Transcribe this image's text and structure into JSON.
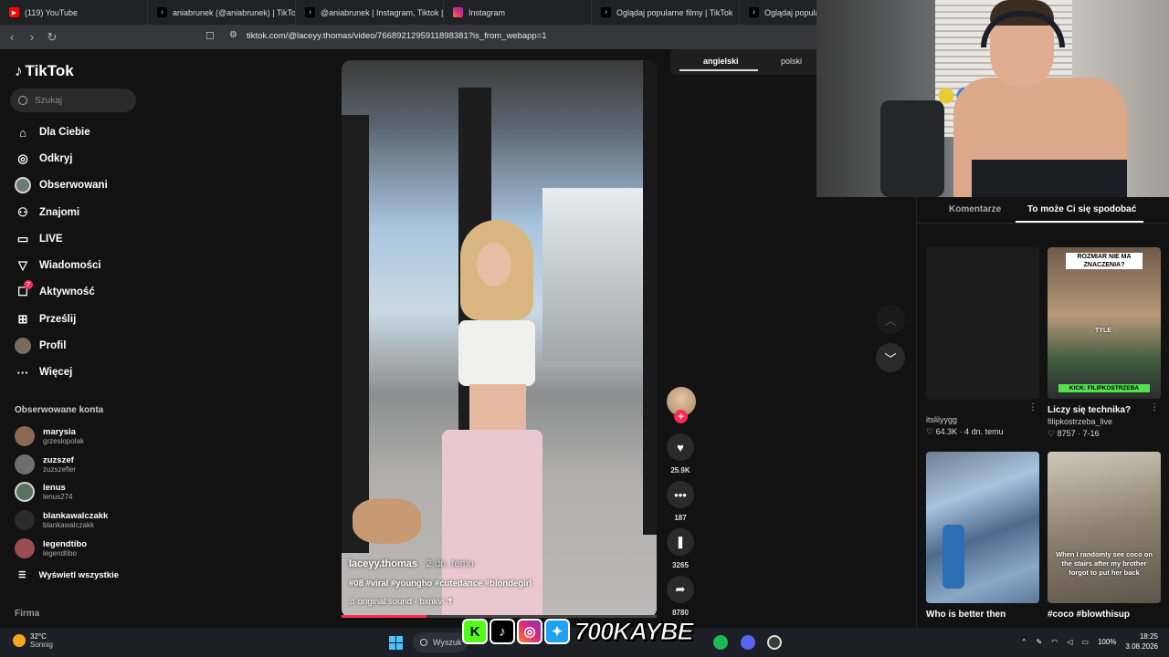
{
  "browser": {
    "tabs": [
      {
        "label": "(119) YouTube",
        "icon": "youtube-icon"
      },
      {
        "label": "aniabrunek (@aniabrunek) | TikTok",
        "icon": "tiktok-icon"
      },
      {
        "label": "@aniabrunek | Instagram, Tiktok | Li",
        "icon": "tiktok-icon"
      },
      {
        "label": "Instagram",
        "icon": "instagram-icon"
      },
      {
        "label": "Oglądaj popularne filmy | TikTok",
        "icon": "tiktok-icon"
      },
      {
        "label": "Oglądaj popularne fi",
        "icon": "tiktok-icon"
      }
    ],
    "url": "tiktok.com/@laceyy.thomas/video/7668921295911898381?is_from_webapp=1"
  },
  "sidebar": {
    "logo": "TikTok",
    "search_placeholder": "Szukaj",
    "nav": [
      {
        "label": "Dla Ciebie",
        "icon": "home-icon"
      },
      {
        "label": "Odkryj",
        "icon": "compass-icon"
      },
      {
        "label": "Obserwowani",
        "icon": "avatar-icon"
      },
      {
        "label": "Znajomi",
        "icon": "friends-icon"
      },
      {
        "label": "LIVE",
        "icon": "live-icon"
      },
      {
        "label": "Wiadomości",
        "icon": "messages-icon"
      },
      {
        "label": "Aktywność",
        "icon": "activity-icon",
        "badge": "7"
      },
      {
        "label": "Prześlij",
        "icon": "upload-icon"
      },
      {
        "label": "Profil",
        "icon": "profile-icon"
      },
      {
        "label": "Więcej",
        "icon": "more-icon"
      }
    ],
    "followed_title": "Obserwowane konta",
    "followed": [
      {
        "name": "marysia",
        "handle": "grzeslopolak",
        "color": "#8a6a55"
      },
      {
        "name": "zuzszef",
        "handle": "zuzszefler",
        "color": "#6e6e6e"
      },
      {
        "name": "lenus",
        "handle": "lenus274",
        "color": "#5a7060"
      },
      {
        "name": "blankawalczakk",
        "handle": "blankawalczakk",
        "color": "#2b2b2b"
      },
      {
        "name": "legendtibo",
        "handle": "legendtibo",
        "color": "#9a4f4f"
      }
    ],
    "show_all": "Wyświetl wszystkie",
    "footer": "Firma"
  },
  "video": {
    "username": "laceyy.thomas",
    "time": " · 2 dn. temu",
    "tags": "#08 #viral #youngho #cutedance #blondegirl",
    "sound": "original sound - bxnkvi ✝",
    "progress": 0.27
  },
  "actions": {
    "likes": "25.9K",
    "comments": "187",
    "saves": "3265",
    "shares": "8780"
  },
  "language": {
    "active": "angielski",
    "other": "polski"
  },
  "rpanel": {
    "tab_comments": "Komentarze",
    "tab_suggested": "To może Ci się spodobać",
    "cards": [
      {
        "title": "",
        "user": "itslilyygg",
        "meta": "♡ 64.3K · 4 dn. temu",
        "thumb_text": ""
      },
      {
        "title": "Liczy się technika?",
        "user": "filipkostrzeba_live",
        "meta": "♡ 8757 · 7-16",
        "thumb_text": "ROZMIAR NIE MA ZNACZENIA?"
      },
      {
        "title": "Who is better then",
        "user": "",
        "meta": "",
        "thumb_text": ""
      },
      {
        "title": "#coco #blowthisup",
        "user": "",
        "meta": "",
        "thumb_text": "When I randomly see coco on the stairs after my brother forgot to put her back"
      }
    ],
    "thumb2_sub": "TYLE",
    "thumb2_banner": "KICK: FILIPKOSTRZEBA"
  },
  "overlay": {
    "brand": "700KAYBE"
  },
  "taskbar": {
    "temp": "32°C",
    "weather": "Sonnig",
    "search": "Wyszuk",
    "battery": "100%",
    "time": "18:25",
    "date": "3.08.2026"
  }
}
